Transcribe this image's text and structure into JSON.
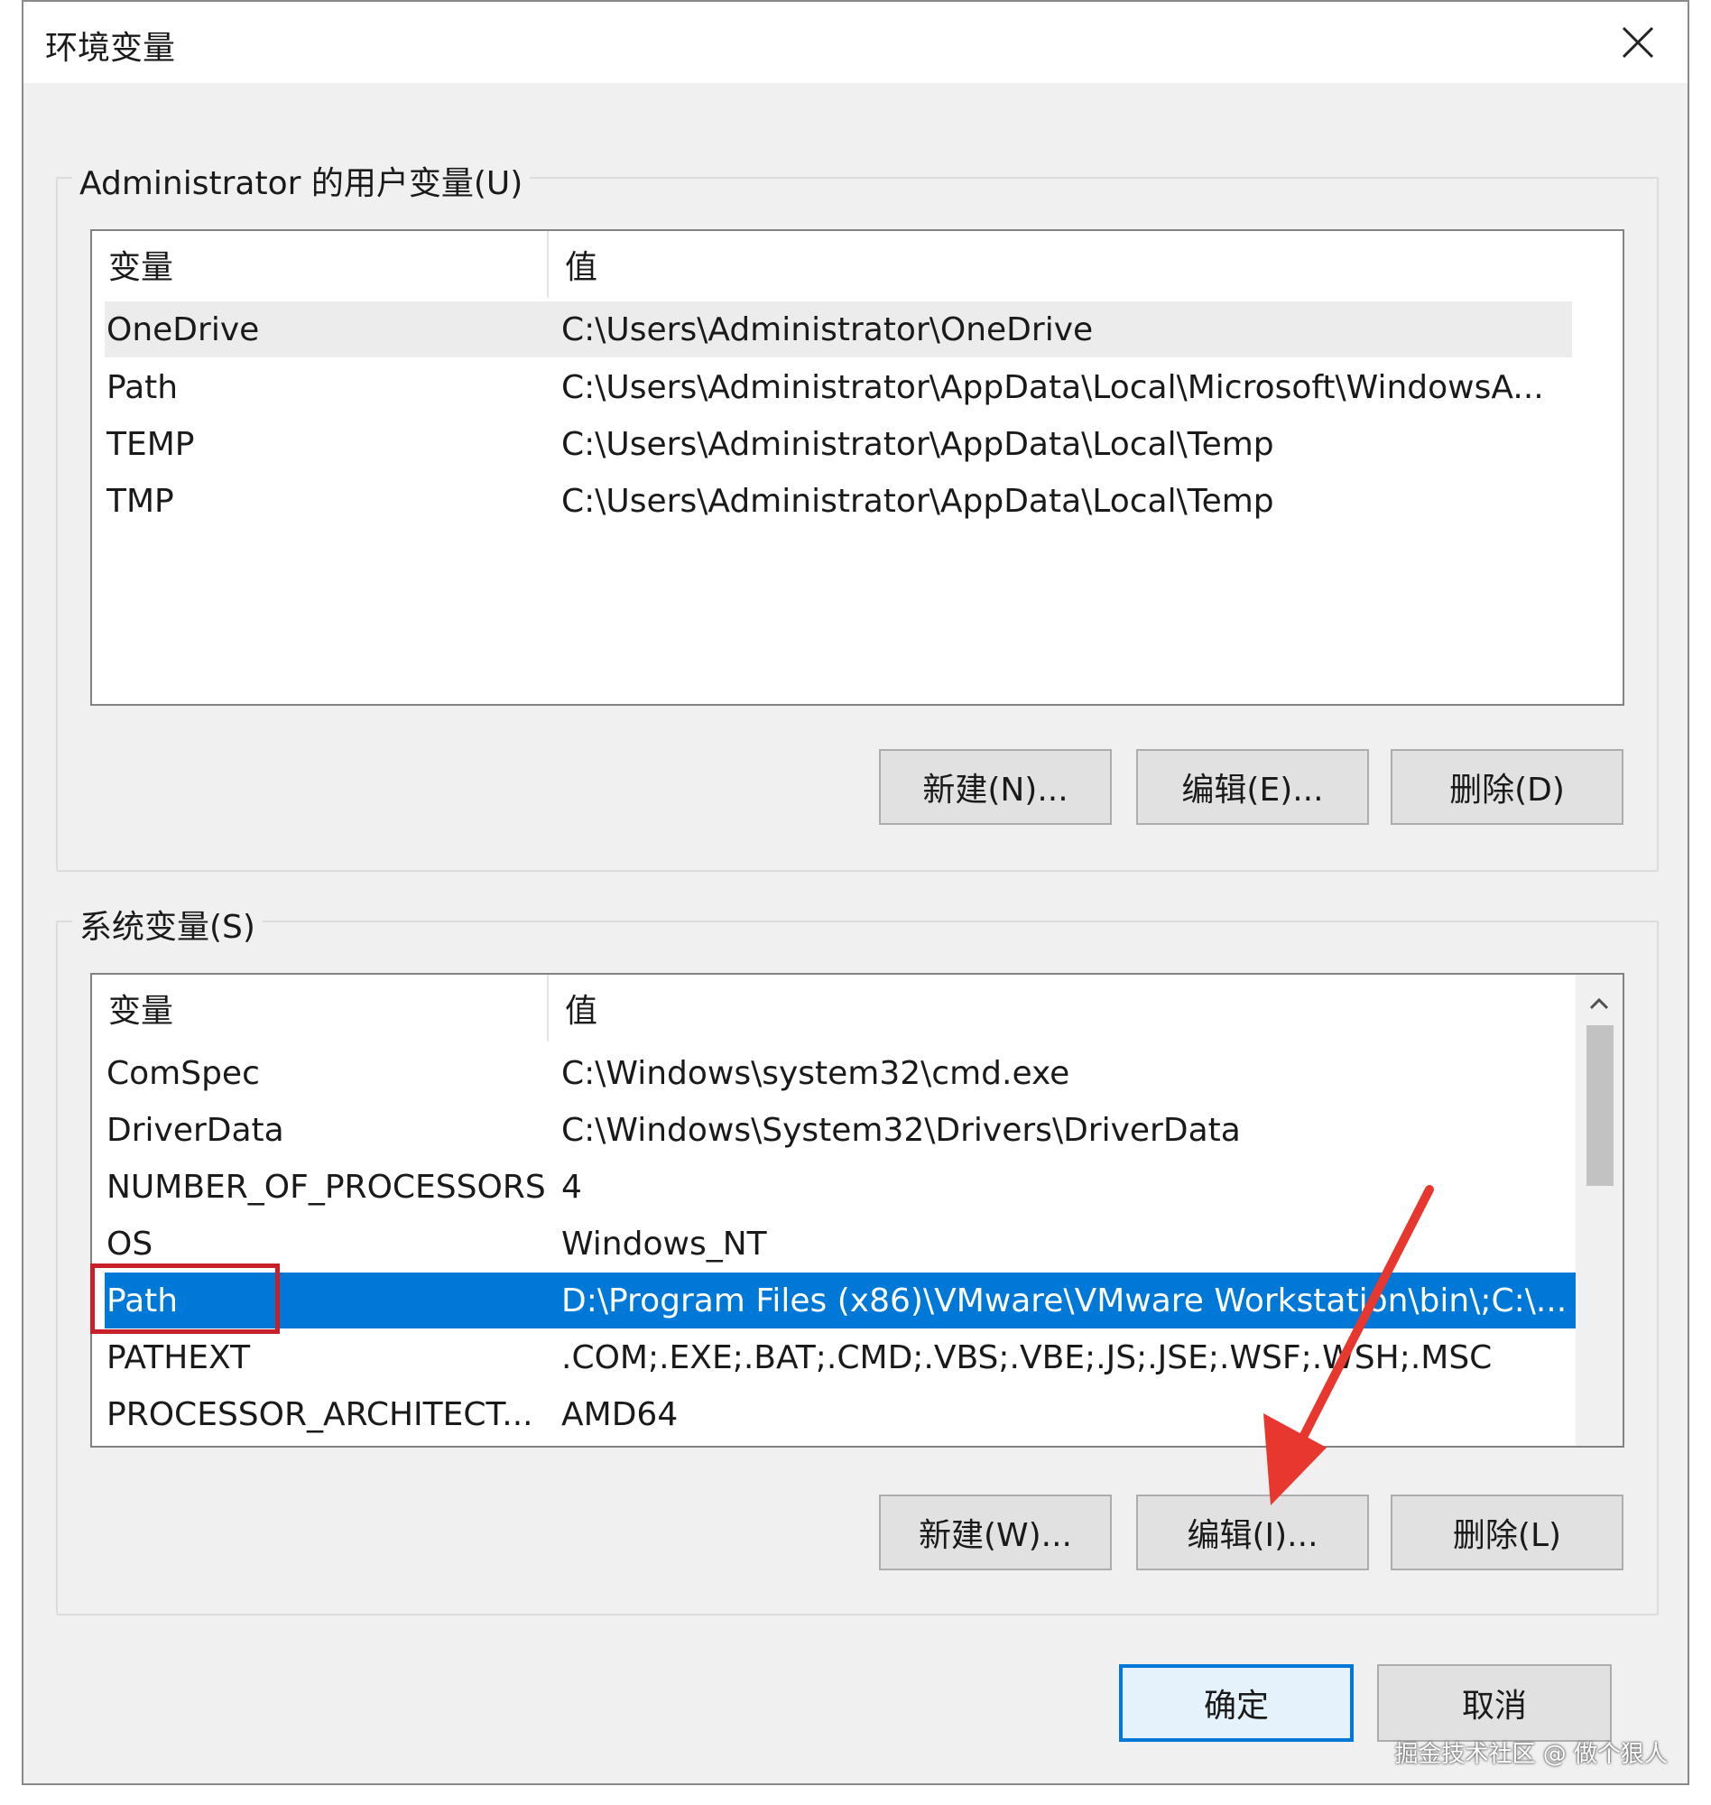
{
  "window": {
    "title": "环境变量",
    "close_icon": "close-icon"
  },
  "user_vars": {
    "group_label": "Administrator 的用户变量(U)",
    "columns": {
      "name": "变量",
      "value": "值"
    },
    "rows": [
      {
        "name": "OneDrive",
        "value": "C:\\Users\\Administrator\\OneDrive"
      },
      {
        "name": "Path",
        "value": "C:\\Users\\Administrator\\AppData\\Local\\Microsoft\\WindowsA..."
      },
      {
        "name": "TEMP",
        "value": "C:\\Users\\Administrator\\AppData\\Local\\Temp"
      },
      {
        "name": "TMP",
        "value": "C:\\Users\\Administrator\\AppData\\Local\\Temp"
      }
    ],
    "buttons": {
      "new": "新建(N)...",
      "edit": "编辑(E)...",
      "delete": "删除(D)"
    }
  },
  "system_vars": {
    "group_label": "系统变量(S)",
    "columns": {
      "name": "变量",
      "value": "值"
    },
    "rows": [
      {
        "name": "ComSpec",
        "value": "C:\\Windows\\system32\\cmd.exe"
      },
      {
        "name": "DriverData",
        "value": "C:\\Windows\\System32\\Drivers\\DriverData"
      },
      {
        "name": "NUMBER_OF_PROCESSORS",
        "value": "4"
      },
      {
        "name": "OS",
        "value": "Windows_NT"
      },
      {
        "name": "Path",
        "value": "D:\\Program Files (x86)\\VMware\\VMware Workstation\\bin\\;C:\\..."
      },
      {
        "name": "PATHEXT",
        "value": ".COM;.EXE;.BAT;.CMD;.VBS;.VBE;.JS;.JSE;.WSF;.WSH;.MSC"
      },
      {
        "name": "PROCESSOR_ARCHITECT...",
        "value": "AMD64"
      }
    ],
    "buttons": {
      "new": "新建(W)...",
      "edit": "编辑(I)...",
      "delete": "删除(L)"
    }
  },
  "footer": {
    "ok": "确定",
    "cancel": "取消"
  },
  "watermark": "掘金技术社区 @ 做个狠人",
  "colors": {
    "selection": "#0078d7",
    "annotation": "#c8202a",
    "arrow": "#e8372e"
  }
}
